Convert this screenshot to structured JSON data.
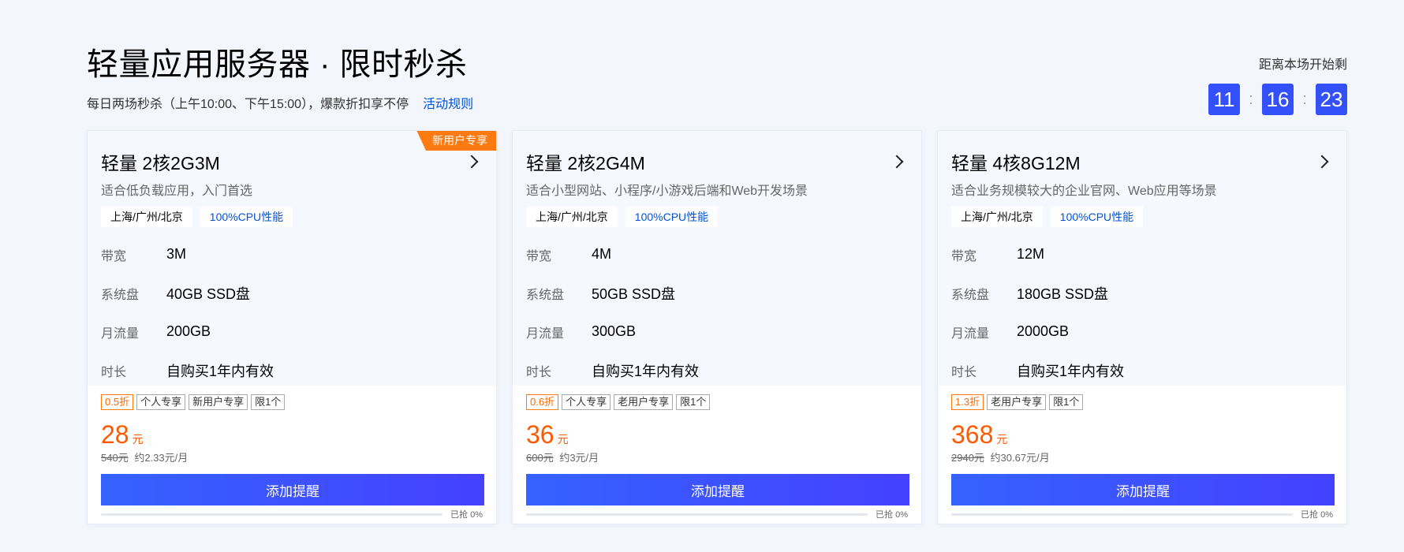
{
  "header": {
    "title": "轻量应用服务器 · 限时秒杀",
    "subtitle": "每日两场秒杀（上午10:00、下午15:00），爆款折扣享不停",
    "rules_link": "活动规则"
  },
  "countdown": {
    "label": "距离本场开始剩",
    "hours": "11",
    "minutes": "16",
    "seconds": "23",
    "separator": ":"
  },
  "spec_labels": {
    "bandwidth": "带宽",
    "disk": "系统盘",
    "traffic": "月流量",
    "duration": "时长"
  },
  "cards": [
    {
      "ribbon": "新用户专享",
      "title": "轻量 2核2G3M",
      "desc": "适合低负载应用，入门首选",
      "region_tag": "上海/广州/北京",
      "cpu_tag": "100%CPU性能",
      "bandwidth": "3M",
      "disk": "40GB SSD盘",
      "traffic": "200GB",
      "duration": "自购买1年内有效",
      "badges": [
        "0.5折",
        "个人专享",
        "新用户专享",
        "限1个"
      ],
      "price": "28",
      "price_unit": "元",
      "original_price": "540元",
      "monthly": "约2.33元/月",
      "button": "添加提醒",
      "sold_text": "已抢 0%",
      "sold_fraction": 0
    },
    {
      "ribbon": "",
      "title": "轻量 2核2G4M",
      "desc": "适合小型网站、小程序/小游戏后端和Web开发场景",
      "region_tag": "上海/广州/北京",
      "cpu_tag": "100%CPU性能",
      "bandwidth": "4M",
      "disk": "50GB SSD盘",
      "traffic": "300GB",
      "duration": "自购买1年内有效",
      "badges": [
        "0.6折",
        "个人专享",
        "老用户专享",
        "限1个"
      ],
      "price": "36",
      "price_unit": "元",
      "original_price": "600元",
      "monthly": "约3元/月",
      "button": "添加提醒",
      "sold_text": "已抢 0%",
      "sold_fraction": 0
    },
    {
      "ribbon": "",
      "title": "轻量 4核8G12M",
      "desc": "适合业务规模较大的企业官网、Web应用等场景",
      "region_tag": "上海/广州/北京",
      "cpu_tag": "100%CPU性能",
      "bandwidth": "12M",
      "disk": "180GB SSD盘",
      "traffic": "2000GB",
      "duration": "自购买1年内有效",
      "badges": [
        "1.3折",
        "老用户专享",
        "限1个"
      ],
      "price": "368",
      "price_unit": "元",
      "original_price": "2940元",
      "monthly": "约30.67元/月",
      "button": "添加提醒",
      "sold_text": "已抢 0%",
      "sold_fraction": 0
    }
  ]
}
